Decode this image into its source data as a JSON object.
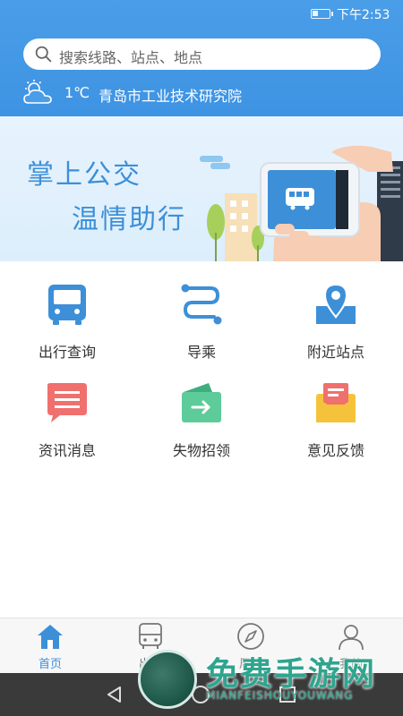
{
  "status_bar": {
    "time": "下午2:53"
  },
  "search": {
    "placeholder": "搜索线路、站点、地点"
  },
  "weather": {
    "temperature": "1℃",
    "location": "青岛市工业技术研究院",
    "icon": "partly-cloudy-icon"
  },
  "banner": {
    "slogan_line1": "掌上公交",
    "slogan_line2": "温情助行"
  },
  "features": [
    {
      "label": "出行查询",
      "icon": "bus-icon",
      "color": "#3d8fd8"
    },
    {
      "label": "导乘",
      "icon": "route-icon",
      "color": "#3d8fd8"
    },
    {
      "label": "附近站点",
      "icon": "location-pin-icon",
      "color": "#3d8fd8"
    },
    {
      "label": "资讯消息",
      "icon": "message-icon",
      "color": "#f0706e"
    },
    {
      "label": "失物招领",
      "icon": "wallet-icon",
      "color": "#5ecb9a"
    },
    {
      "label": "意见反馈",
      "icon": "envelope-icon",
      "color": "#f5c33b"
    }
  ],
  "bottom_nav": [
    {
      "label": "首页",
      "icon": "home-icon",
      "active": true
    },
    {
      "label": "出行",
      "icon": "bus-icon",
      "active": false
    },
    {
      "label": "周边",
      "icon": "compass-icon",
      "active": false
    },
    {
      "label": "我的",
      "icon": "user-icon",
      "active": false
    }
  ],
  "watermark": {
    "title": "免费手游网",
    "subtitle": "MIANFEISHOUYOUWANG"
  },
  "colors": {
    "header_blue": "#4a9ee8",
    "accent_blue": "#3d8fd8"
  }
}
